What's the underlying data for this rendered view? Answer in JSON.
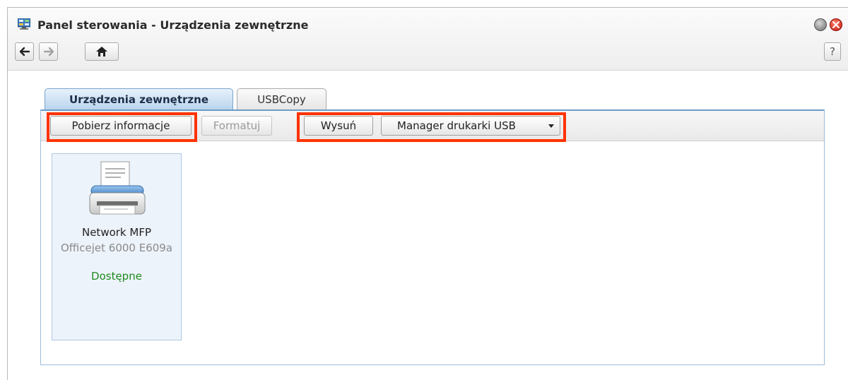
{
  "window": {
    "title": "Panel sterowania - Urządzenia zewnętrzne",
    "help_label": "?"
  },
  "tabs": [
    {
      "label": "Urządzenia zewnętrzne",
      "active": true
    },
    {
      "label": "USBCopy",
      "active": false
    }
  ],
  "toolbar": {
    "get_info_label": "Pobierz informacje",
    "format_label": "Formatuj",
    "eject_label": "Wysuń",
    "usb_printer_manager_label": "Manager drukarki USB"
  },
  "devices": [
    {
      "name": "Network MFP",
      "model": "Officejet 6000 E609a",
      "status": "Dostępne",
      "icon": "printer-icon"
    }
  ],
  "colors": {
    "highlight": "#ff3300",
    "status_available": "#1f8a1f",
    "tab_active": "#b9d5ee"
  }
}
